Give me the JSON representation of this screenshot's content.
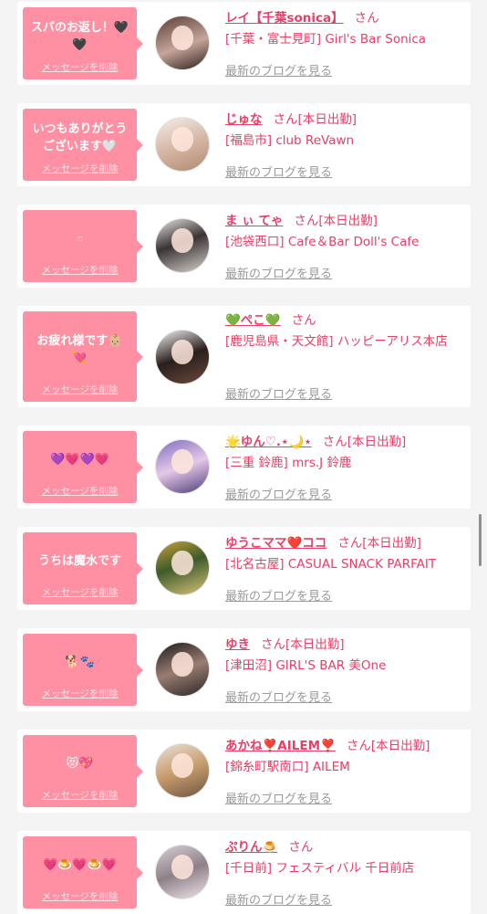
{
  "colors": {
    "bubble": "#ff8fa3",
    "name": "#e83e67",
    "blog_link": "#9a9a9a",
    "background": "#f4f4f4"
  },
  "delete_label": "メッセージを削除",
  "blog_label": "最新のブログを見る",
  "entries": [
    {
      "message": "スパのお返し！🖤\n🖤",
      "name": "レイ【千葉sonica】",
      "san": "さん",
      "shop": "[千葉・富士見町] Girl's Bar Sonica"
    },
    {
      "message": "いつもありがとうございます🤍",
      "name": "じゅな",
      "san": "さん[本日出勤]",
      "shop": "[福島市] club ReVawn"
    },
    {
      "message": "ෆ",
      "name": "ま ぃ てゃ",
      "san": "さん[本日出勤]",
      "shop": "[池袋西口] Cafe＆Bar Doll's Cafe"
    },
    {
      "message": "お疲れ様です👶🏼\n💘",
      "name": "💚ぺこ💚",
      "san": "さん",
      "shop": "[鹿児島県・天文館] ハッピーアリス本店"
    },
    {
      "message": "💜💗💜💗",
      "name": "🌟ゆん♡.⋆🌙⋆",
      "san": "さん[本日出勤]",
      "shop": "[三重 鈴鹿] mrs.J 鈴鹿"
    },
    {
      "message": "うちは魔水です",
      "name": "ゆうこママ❤️ココ",
      "san": "さん[本日出勤]",
      "shop": "[北名古屋] CASUAL SNACK PARFAIT"
    },
    {
      "message": "🐕🐾",
      "name": "ゆき",
      "san": "さん[本日出勤]",
      "shop": "[津田沼] GIRL'S BAR 美One"
    },
    {
      "message": "😻💖",
      "name": "あかね❣️AILEM❣️",
      "san": "さん[本日出勤]",
      "shop": "[錦糸町駅南口] AILEM"
    },
    {
      "message": "💗🍮💗🍮💗",
      "name": "ぷりん🍮",
      "san": "さん",
      "shop": "[千日前] フェスティバル 千日前店"
    }
  ]
}
